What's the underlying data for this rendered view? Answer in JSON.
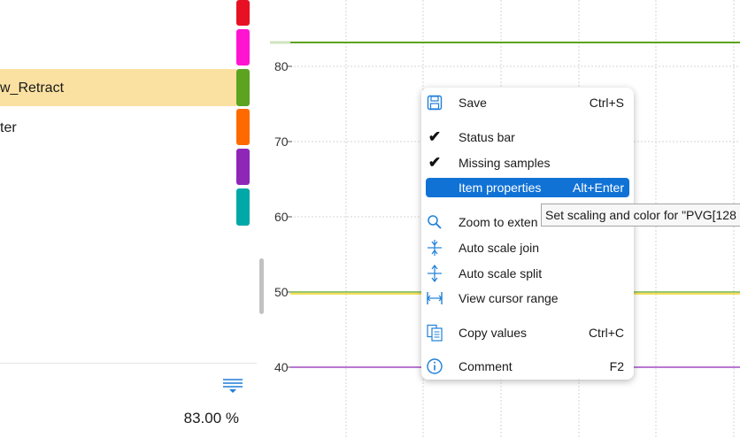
{
  "left_panel": {
    "rows": [
      {
        "label": "w_Retract",
        "selected": true
      },
      {
        "label": "ter",
        "selected": false
      }
    ],
    "swatch_colors": [
      "#e81123",
      "#ff14d2",
      "#5ca320",
      "#ff6a00",
      "#8e26b8",
      "#00a8a8"
    ],
    "selected_row_color": "#fbe1a1",
    "filter_icon": "filter-lines-icon",
    "percent": "83.00 %"
  },
  "plot": {
    "y_ticks": [
      "80",
      "70",
      "60",
      "50",
      "40"
    ],
    "grid_color": "#d6d6d6",
    "trace_colors": [
      "#5ca320",
      "#f2d421",
      "#8e26b8"
    ]
  },
  "context_menu": {
    "items": [
      {
        "label": "Save",
        "shortcut": "Ctrl+S",
        "icon": "save-icon"
      },
      {
        "label": "Status bar",
        "shortcut": "",
        "icon": "checkmark-icon"
      },
      {
        "label": "Missing samples",
        "shortcut": "",
        "icon": "checkmark-icon"
      },
      {
        "label": "Item properties",
        "shortcut": "Alt+Enter",
        "icon": "",
        "highlighted": true
      },
      {
        "label": "Zoom to exten",
        "shortcut": "",
        "icon": "magnifier-icon"
      },
      {
        "label": "Auto scale join",
        "shortcut": "",
        "icon": "auto-scale-join-icon"
      },
      {
        "label": "Auto scale split",
        "shortcut": "",
        "icon": "auto-scale-split-icon"
      },
      {
        "label": "View cursor range",
        "shortcut": "",
        "icon": "cursor-range-icon"
      },
      {
        "label": "Copy values",
        "shortcut": "Ctrl+C",
        "icon": "copy-values-icon"
      },
      {
        "label": "Comment",
        "shortcut": "F2",
        "icon": "info-icon"
      }
    ],
    "highlight_color": "#1172d6"
  },
  "tooltip": {
    "text": "Set scaling and color for \"PVG[128"
  }
}
